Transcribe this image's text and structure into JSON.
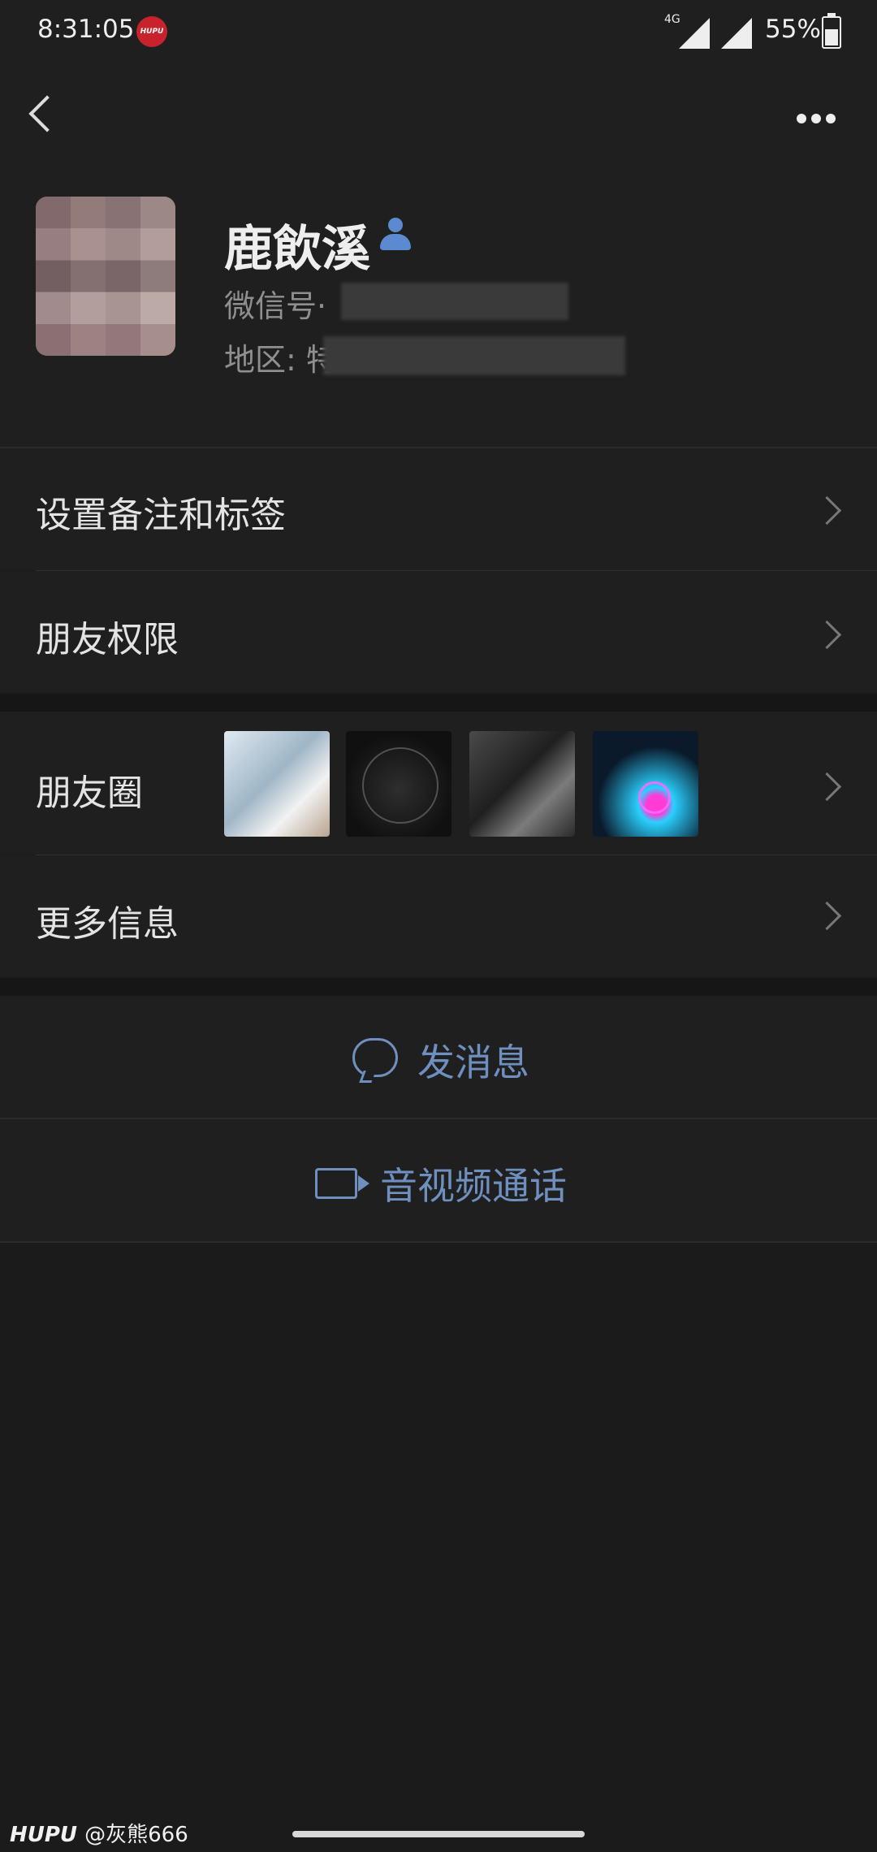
{
  "status_bar": {
    "time": "8:31:05",
    "network": "4G",
    "battery": "55%",
    "battery_level": 0.55,
    "app_badge": "HUPU"
  },
  "top_bar": {
    "back_icon": "chevron-left-icon",
    "more_icon": "more-horizontal-icon"
  },
  "profile": {
    "name": "鹿飲溪",
    "wechat_id_label": "微信号·",
    "region_label": "地区: 特"
  },
  "menu": {
    "remark_tags": "设置备注和标签",
    "friend_permissions": "朋友权限",
    "moments": "朋友圈",
    "more_info": "更多信息"
  },
  "actions": {
    "send_message": "发消息",
    "av_call": "音视频通话"
  },
  "watermark": {
    "brand": "HUPU",
    "user": "@灰熊666"
  },
  "colors": {
    "background": "#1b1b1b",
    "row_bg": "#1f1f1f",
    "action_text": "#6f8fbf",
    "user_badge": "#5b8ad0"
  }
}
